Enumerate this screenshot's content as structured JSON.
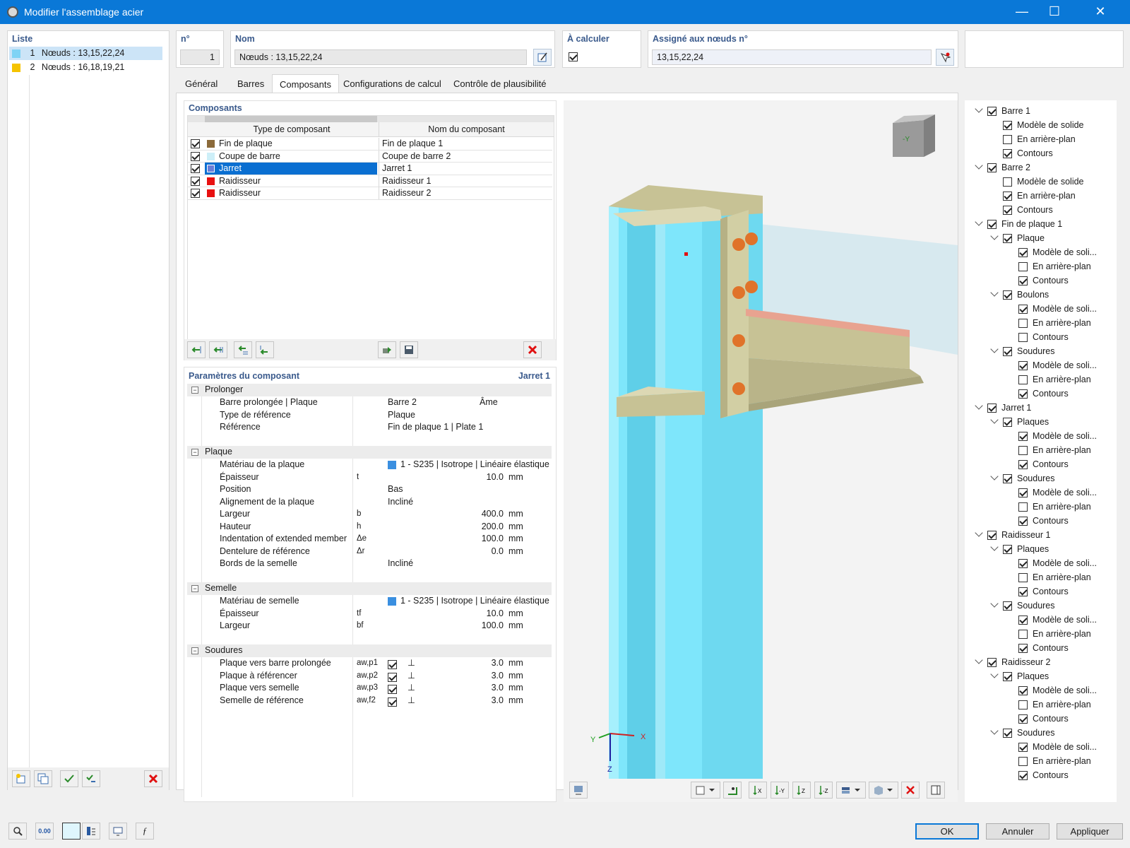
{
  "window": {
    "title": "Modifier l'assemblage acier",
    "minimize": "—",
    "maximize": "☐",
    "close": "✕"
  },
  "list": {
    "header": "Liste",
    "items": [
      {
        "num": "1",
        "label": "Nœuds : 13,15,22,24",
        "color": "#7fd3f5"
      },
      {
        "num": "2",
        "label": "Nœuds : 16,18,19,21",
        "color": "#f5c300"
      }
    ]
  },
  "fields": {
    "no_label": "n°",
    "no_value": "1",
    "name_label": "Nom",
    "name_value": "Nœuds : 13,15,22,24",
    "calc_label": "À calculer",
    "assigned_label": "Assigné aux nœuds n°",
    "assigned_value": "13,15,22,24"
  },
  "tabs": [
    "Général",
    "Barres",
    "Composants",
    "Configurations de calcul",
    "Contrôle de plausibilité"
  ],
  "components": {
    "header": "Composants",
    "col_type": "Type de composant",
    "col_name": "Nom du composant",
    "rows": [
      {
        "type": "Fin de plaque",
        "name": "Fin de plaque 1",
        "color": "#8b6a3a"
      },
      {
        "type": "Coupe de barre",
        "name": "Coupe de barre 2",
        "color": "#cdeff8"
      },
      {
        "type": "Jarret",
        "name": "Jarret 1",
        "color": "#6a7ed8"
      },
      {
        "type": "Raidisseur",
        "name": "Raidisseur 1",
        "color": "#e81010"
      },
      {
        "type": "Raidisseur",
        "name": "Raidisseur 2",
        "color": "#e81010"
      }
    ]
  },
  "params": {
    "header": "Paramètres du composant",
    "current": "Jarret 1",
    "groups": {
      "prolonger": "Prolonger",
      "plaque": "Plaque",
      "semelle": "Semelle",
      "soudures": "Soudures"
    },
    "prolonger": {
      "r1_label": "Barre prolongée | Plaque",
      "r1_val": "Barre 2",
      "r1_val2": "Âme",
      "r2_label": "Type de référence",
      "r2_val": "Plaque",
      "r3_label": "Référence",
      "r3_val": "Fin de plaque 1 | Plate 1"
    },
    "plaque": {
      "mat_label": "Matériau de la plaque",
      "mat_val": "1 - S235 | Isotrope | Linéaire élastique",
      "ep_label": "Épaisseur",
      "ep_sym": "t",
      "ep_val": "10.0",
      "ep_unit": "mm",
      "pos_label": "Position",
      "pos_val": "Bas",
      "al_label": "Alignement de la plaque",
      "al_val": "Incliné",
      "la_label": "Largeur",
      "la_sym": "b",
      "la_val": "400.0",
      "la_unit": "mm",
      "ha_label": "Hauteur",
      "ha_sym": "h",
      "ha_val": "200.0",
      "ha_unit": "mm",
      "in_label": "Indentation of extended member",
      "in_sym": "Δe",
      "in_val": "100.0",
      "in_unit": "mm",
      "de_label": "Dentelure de référence",
      "de_sym": "Δr",
      "de_val": "0.0",
      "de_unit": "mm",
      "bo_label": "Bords de la semelle",
      "bo_val": "Incliné"
    },
    "semelle": {
      "mat_label": "Matériau de semelle",
      "mat_val": "1 - S235 | Isotrope | Linéaire élastique",
      "ep_label": "Épaisseur",
      "ep_sym": "tf",
      "ep_val": "10.0",
      "ep_unit": "mm",
      "la_label": "Largeur",
      "la_sym": "bf",
      "la_val": "100.0",
      "la_unit": "mm"
    },
    "soudures": [
      {
        "label": "Plaque vers barre prolongée",
        "sym": "aw,p1",
        "val": "3.0",
        "unit": "mm"
      },
      {
        "label": "Plaque à référencer",
        "sym": "aw,p2",
        "val": "3.0",
        "unit": "mm"
      },
      {
        "label": "Plaque vers semelle",
        "sym": "aw,p3",
        "val": "3.0",
        "unit": "mm"
      },
      {
        "label": "Semelle de référence",
        "sym": "aw,f2",
        "val": "3.0",
        "unit": "mm"
      }
    ]
  },
  "viewport": {
    "axis_x": "X",
    "axis_y": "Y",
    "axis_z": "Z",
    "cube_label": "-Y"
  },
  "tree": {
    "barre1": "Barre 1",
    "barre2": "Barre 2",
    "finplaque": "Fin de plaque 1",
    "jarret": "Jarret 1",
    "raid1": "Raidisseur 1",
    "raid2": "Raidisseur 2",
    "plaque": "Plaque",
    "plaques": "Plaques",
    "boulons": "Boulons",
    "soudures": "Soudures",
    "solide": "Modèle de solide",
    "solide_short": "Modèle de soli...",
    "arriere": "En arrière-plan",
    "contours": "Contours"
  },
  "buttons": {
    "ok": "OK",
    "cancel": "Annuler",
    "apply": "Appliquer",
    "units": "0.00"
  },
  "colors": {
    "accent": "#0a78d7",
    "column": "#7ee6fb",
    "plate": "#c7c295",
    "bolt": "#e0732a"
  }
}
